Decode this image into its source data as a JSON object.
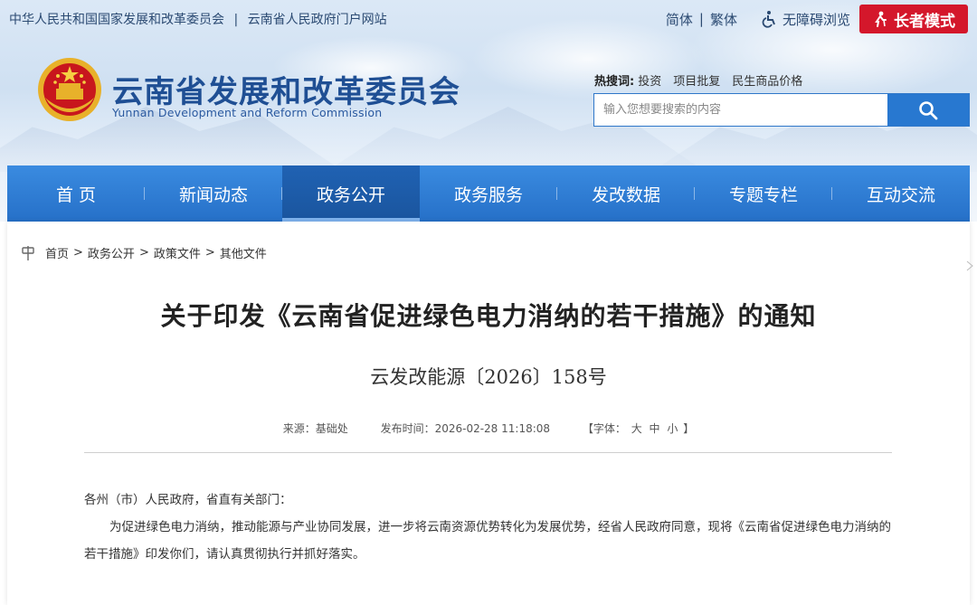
{
  "topbar": {
    "sites": [
      "中华人民共和国国家发展和改革委员会",
      "云南省人民政府门户网站"
    ],
    "separator": "|",
    "lang_simplified": "简体",
    "lang_traditional": "繁体",
    "accessibility": "无障碍浏览",
    "elder_mode": "长者模式"
  },
  "brand": {
    "title": "云南省发展和改革委员会",
    "subtitle": "Yunnan Development and Reform Commission"
  },
  "hot_search": {
    "label": "热搜词:",
    "items": [
      "投资",
      "项目批复",
      "民生商品价格"
    ]
  },
  "search": {
    "placeholder": "输入您想要搜索的内容"
  },
  "nav": {
    "items": [
      "首 页",
      "新闻动态",
      "政务公开",
      "政务服务",
      "发改数据",
      "专题专栏",
      "互动交流"
    ],
    "active_index": 2
  },
  "breadcrumb": {
    "items": [
      "首页",
      "政务公开",
      "政策文件",
      "其他文件"
    ],
    "separator": ">"
  },
  "article": {
    "title": "关于印发《云南省促进绿色电力消纳的若干措施》的通知",
    "doc_number": "云发改能源〔2026〕158号",
    "source": "来源：基础处",
    "publish_time": "发布时间：2026-02-28 11:18:08",
    "font_size_label": "【字体：",
    "font_sizes": [
      "大",
      "中",
      "小"
    ],
    "font_size_end": "】",
    "salutation": "各州（市）人民政府，省直有关部门：",
    "paragraph": "为促进绿色电力消纳，推动能源与产业协同发展，进一步将云南资源优势转化为发展优势，经省人民政府同意，现将《云南省促进绿色电力消纳的若干措施》印发你们，请认真贯彻执行并抓好落实。"
  },
  "colors": {
    "nav_blue": "#2d7bd3",
    "nav_active": "#1c5aa5",
    "elder_red": "#d4172b",
    "title_blue": "#1f4f94"
  }
}
